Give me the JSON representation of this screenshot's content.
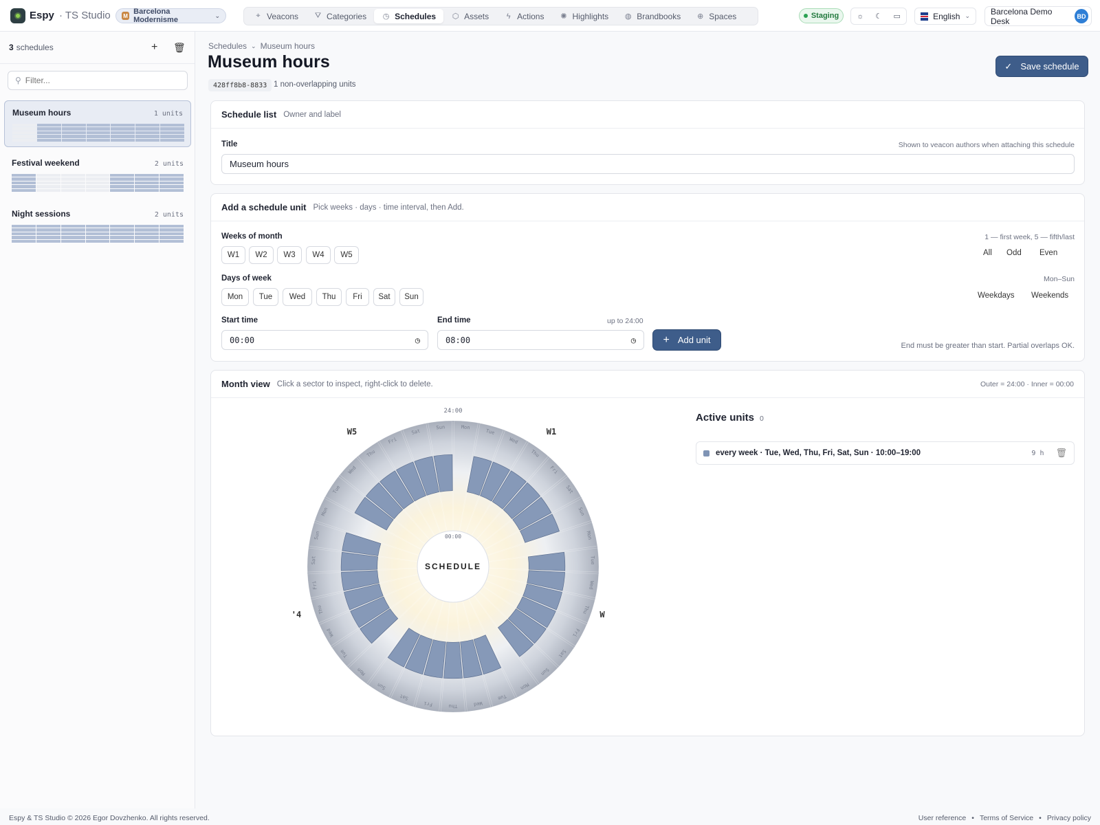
{
  "app": {
    "brand": "Espy",
    "sub": "· TS Studio"
  },
  "org": {
    "initial": "M",
    "name": "Barcelona Modernisme"
  },
  "nav": [
    {
      "icon": "pin-icon",
      "glyph": "⌖",
      "label": "Veacons"
    },
    {
      "icon": "filter-icon",
      "glyph": "⛛",
      "label": "Categories"
    },
    {
      "icon": "clock-icon",
      "glyph": "◷",
      "label": "Schedules",
      "active": true
    },
    {
      "icon": "box-icon",
      "glyph": "⬡",
      "label": "Assets"
    },
    {
      "icon": "bolt-icon",
      "glyph": "ϟ",
      "label": "Actions"
    },
    {
      "icon": "sparkle-icon",
      "glyph": "✺",
      "label": "Highlights"
    },
    {
      "icon": "palette-icon",
      "glyph": "◍",
      "label": "Brandbooks"
    },
    {
      "icon": "globe-icon",
      "glyph": "⊕",
      "label": "Spaces"
    }
  ],
  "env": "Staging",
  "language": "English",
  "user": {
    "name": "Barcelona Demo Desk",
    "initials": "BD"
  },
  "sidebar": {
    "count": "3",
    "count_label": "schedules",
    "filter_placeholder": "Filter...",
    "schedules": [
      {
        "title": "Museum hours",
        "units": "1 units",
        "selected": true,
        "pattern": [
          [
            0,
            1,
            1,
            1,
            1,
            1,
            1
          ],
          [
            0,
            1,
            1,
            1,
            1,
            1,
            1
          ],
          [
            0,
            1,
            1,
            1,
            1,
            1,
            1
          ],
          [
            0,
            1,
            1,
            1,
            1,
            1,
            1
          ],
          [
            0,
            1,
            1,
            1,
            1,
            1,
            1
          ]
        ]
      },
      {
        "title": "Festival weekend",
        "units": "2 units",
        "selected": false,
        "pattern": [
          [
            1,
            0,
            0,
            0,
            1,
            1,
            1
          ],
          [
            1,
            0,
            0,
            0,
            1,
            1,
            1
          ],
          [
            1,
            0,
            0,
            0,
            1,
            1,
            1
          ],
          [
            1,
            0,
            0,
            0,
            1,
            1,
            1
          ],
          [
            1,
            0,
            0,
            0,
            1,
            1,
            1
          ]
        ]
      },
      {
        "title": "Night sessions",
        "units": "2 units",
        "selected": false,
        "pattern": [
          [
            1,
            1,
            1,
            1,
            1,
            1,
            1
          ],
          [
            1,
            1,
            1,
            1,
            1,
            1,
            1
          ],
          [
            1,
            1,
            1,
            1,
            1,
            1,
            1
          ],
          [
            1,
            1,
            1,
            1,
            1,
            1,
            1
          ],
          [
            1,
            1,
            1,
            1,
            1,
            1,
            1
          ]
        ]
      }
    ]
  },
  "breadcrumb": {
    "root": "Schedules",
    "current": "Museum hours"
  },
  "page": {
    "title": "Museum hours",
    "id": "428ff8b8-8833",
    "overlap_note": "1 non-overlapping units",
    "save_label": "Save schedule"
  },
  "schedule_list": {
    "title": "Schedule list",
    "subtitle": "Owner and label",
    "field_label": "Title",
    "field_hint": "Shown to veacon authors when attaching this schedule",
    "field_value": "Museum hours"
  },
  "add_unit": {
    "title": "Add a schedule unit",
    "subtitle": "Pick weeks · days · time interval, then Add.",
    "weeks_label": "Weeks of month",
    "weeks_hint": "1 — first week, 5 — fifth/last",
    "weeks": [
      "W1",
      "W2",
      "W3",
      "W4",
      "W5"
    ],
    "weeks_presets": [
      "All",
      "Odd",
      "Even"
    ],
    "days_label": "Days of week",
    "days_hint": "Mon–Sun",
    "days": [
      "Mon",
      "Tue",
      "Wed",
      "Thu",
      "Fri",
      "Sat",
      "Sun"
    ],
    "days_presets": [
      "Weekdays",
      "Weekends"
    ],
    "start_label": "Start time",
    "start_value": "00:00",
    "end_label": "End time",
    "end_hint": "up to 24:00",
    "end_value": "08:00",
    "add_label": "Add unit",
    "rule_hint": "End must be greater than start. Partial overlaps OK."
  },
  "month_view": {
    "title": "Month view",
    "subtitle": "Click a sector to inspect, right-click to delete.",
    "legend": "Outer = 24:00 · Inner = 00:00",
    "center_label": "SCHEDULE",
    "outer_time": "24:00",
    "inner_time": "00:00",
    "week_labels": [
      "W1",
      "W",
      "'4",
      "W5"
    ],
    "day_abbr": [
      "Mon",
      "Tue",
      "Wed",
      "Thu",
      "Fri",
      "Sat",
      "Sun"
    ],
    "unit_start_h": 10,
    "unit_end_h": 19,
    "unit_days": [
      1,
      2,
      3,
      4,
      5,
      6
    ]
  },
  "active_units": {
    "title": "Active units",
    "count": "0",
    "items": [
      {
        "text": "every week · Tue, Wed, Thu, Fri, Sat, Sun · 10:00–19:00",
        "hours": "9 h",
        "color": "#7f94b5"
      }
    ]
  },
  "footer": {
    "copyright": "Espy & TS Studio © 2026 Egor Dovzhenko. All rights reserved.",
    "links": [
      "User reference",
      "Terms of Service",
      "Privacy policy"
    ]
  },
  "colors": {
    "accent": "#3e5d8a",
    "unit": "#7f94b5",
    "staging": "#2aa152"
  }
}
